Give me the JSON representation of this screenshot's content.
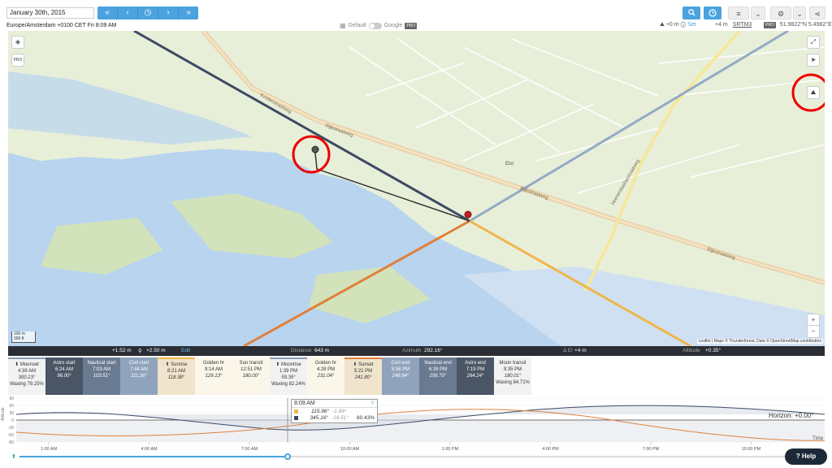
{
  "header": {
    "date": "January 30th, 2015",
    "timezone_line": "Europe/Amsterdam +0100 CET Fri 8:09 AM",
    "nav": [
      "«",
      "‹",
      "◷",
      "›",
      "»"
    ]
  },
  "map_toggle": {
    "left": "Default",
    "right": "Google",
    "badge": "PRO"
  },
  "right_info": {
    "height_offset": "+0 m",
    "set_label": "Set",
    "elevation": "+4 m",
    "source": "SRTM3",
    "badge": "PRO",
    "coords": "51.9822°N 5.4982°E"
  },
  "map": {
    "pro_label": "PRO",
    "scale_m": "100 m",
    "scale_ft": "300 ft",
    "zoom_in": "+",
    "zoom_out": "−",
    "attribution": "Leaflet | Maps © Thunderforest, Data © OpenStreetMap contributors",
    "street_labels": [
      "Rijkstraatweg",
      "Rijkstraatweg",
      "Rijkstraatweg",
      "Kosterstraatweg",
      "Veenendaalsestraatweg",
      "Elst"
    ]
  },
  "info_bar": {
    "left_height": "+1.52 m",
    "dist_height": "+2.50 m",
    "edit": "Edit",
    "distance_label": "Distance",
    "distance_value": "643 m",
    "azimuth_label": "Azimuth",
    "azimuth_value": "292.16°",
    "el_label": "Δ El",
    "el_value": "+4 m",
    "altitude_label": "Altitude",
    "altitude_value": "+0.35°"
  },
  "events": [
    {
      "name": "⬇ Moonset",
      "time": "4:39 AM",
      "angle": "300.23°",
      "extra": "Waxing 79.25%",
      "bg": "#f2f2f2",
      "fg": "#333",
      "bar": "#8a9bb3"
    },
    {
      "name": "Astro start",
      "time": "6:24 AM",
      "angle": "96.00°",
      "extra": "",
      "bg": "#4a5565",
      "fg": "#fff",
      "bar": ""
    },
    {
      "name": "Nautical start",
      "time": "7:03 AM",
      "angle": "103.51°",
      "extra": "",
      "bg": "#6a7a90",
      "fg": "#fff",
      "bar": ""
    },
    {
      "name": "Civil start",
      "time": "7:44 AM",
      "angle": "111.26°",
      "extra": "",
      "bg": "#8fa3bd",
      "fg": "#fff",
      "bar": ""
    },
    {
      "name": "⬆ Sunrise",
      "time": "8:21 AM",
      "angle": "118.38°",
      "extra": "",
      "bg": "#f0e4cc",
      "fg": "#333",
      "bar": "#f0b64a"
    },
    {
      "name": "Golden hr",
      "time": "9:14 AM",
      "angle": "129.13°",
      "extra": "",
      "bg": "#fbf6ea",
      "fg": "#333",
      "bar": ""
    },
    {
      "name": "Sun transit",
      "time": "12:51 PM",
      "angle": "180.00°",
      "extra": "",
      "bg": "#fbf6ea",
      "fg": "#333",
      "bar": ""
    },
    {
      "name": "⬆ Moonrise",
      "time": "1:39 PM",
      "angle": "59.35°",
      "extra": "Waxing 82.24%",
      "bg": "#f2f2f2",
      "fg": "#333",
      "bar": "#8a9bb3"
    },
    {
      "name": "Golden hr",
      "time": "4:28 PM",
      "angle": "231.04°",
      "extra": "",
      "bg": "#fbf6ea",
      "fg": "#333",
      "bar": ""
    },
    {
      "name": "⬇ Sunset",
      "time": "5:21 PM",
      "angle": "241.80°",
      "extra": "",
      "bg": "#f0e4cc",
      "fg": "#333",
      "bar": "#e0803a"
    },
    {
      "name": "Civil end",
      "time": "5:58 PM",
      "angle": "248.94°",
      "extra": "",
      "bg": "#8fa3bd",
      "fg": "#fff",
      "bar": ""
    },
    {
      "name": "Nautical end",
      "time": "6:39 PM",
      "angle": "256.70°",
      "extra": "",
      "bg": "#6a7a90",
      "fg": "#fff",
      "bar": ""
    },
    {
      "name": "Astro end",
      "time": "7:19 PM",
      "angle": "264.24°",
      "extra": "",
      "bg": "#4a5565",
      "fg": "#fff",
      "bar": ""
    },
    {
      "name": "Moon transit",
      "time": "9:35 PM",
      "angle": "180.01°",
      "extra": "Waxing 84.71%",
      "bg": "#f2f2f2",
      "fg": "#333",
      "bar": ""
    }
  ],
  "graph": {
    "y_ticks": [
      "90",
      "60",
      "30",
      "0",
      "-30",
      "-60",
      "-90"
    ],
    "y_label": "Altitude",
    "x_ticks": [
      "1:00 AM",
      "4:00 AM",
      "7:00 AM",
      "10:00 AM",
      "1:00 PM",
      "4:00 PM",
      "7:00 PM",
      "10:00 PM"
    ],
    "horizon_label": "Horizon: +0.00°",
    "time_label": "Time"
  },
  "tooltip": {
    "time": "8:09 AM",
    "sun_az": "115.96°",
    "sun_alt": "-1.89°",
    "moon_az": "345.16°",
    "moon_alt": "-19.51°",
    "moon_illum": "80.43%"
  },
  "help": "? Help",
  "colors": {
    "accent": "#4aa3df",
    "sunrise": "#f0b64a",
    "sunset": "#e0803a",
    "moon": "#3d4a63",
    "water": "#b8d4ef"
  }
}
